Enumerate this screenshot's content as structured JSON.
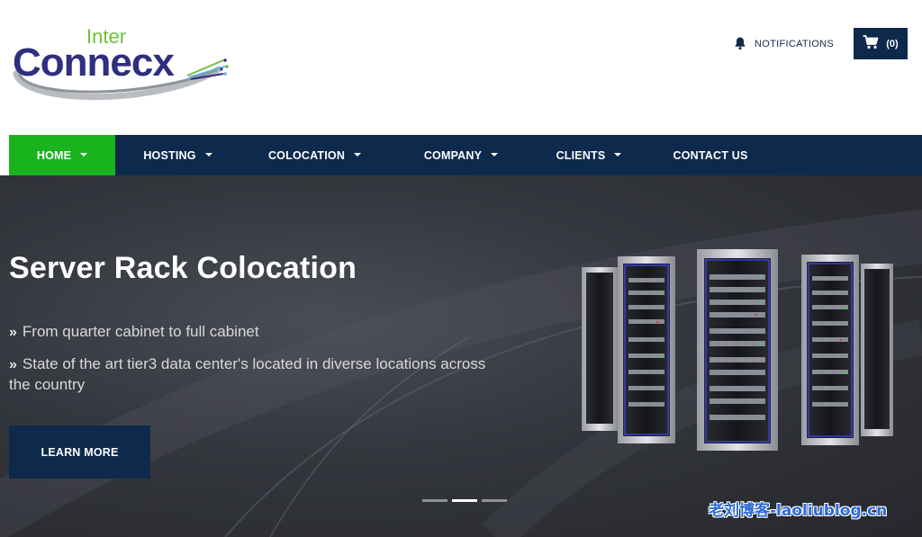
{
  "brand": {
    "logo_top": "Inter",
    "logo_main": "Connecx",
    "colors": {
      "navy": "#0d2a4d",
      "accent_green": "#19b31e",
      "logo_purple": "#2e2f7f",
      "logo_green": "#6fbf3b"
    }
  },
  "header": {
    "notifications_label": "NOTIFICATIONS",
    "notifications_icon": "bell-icon",
    "cart_count": "(0)",
    "cart_icon": "shopping-cart-icon"
  },
  "nav": {
    "items": [
      {
        "label": "HOME",
        "has_dropdown": true,
        "active": true
      },
      {
        "label": "HOSTING",
        "has_dropdown": true,
        "active": false
      },
      {
        "label": "COLOCATION",
        "has_dropdown": true,
        "active": false
      },
      {
        "label": "COMPANY",
        "has_dropdown": true,
        "active": false
      },
      {
        "label": "CLIENTS",
        "has_dropdown": true,
        "active": false
      },
      {
        "label": "CONTACT US",
        "has_dropdown": false,
        "active": false
      }
    ]
  },
  "hero": {
    "title": "Server Rack Colocation",
    "bullets": [
      "From quarter cabinet to full cabinet",
      "State of the art tier3 data center's located in diverse locations across the country"
    ],
    "cta_label": "LEARN MORE",
    "slides_total": 3,
    "active_slide": 2
  },
  "watermark": "老刘博客-laoliublog.cn"
}
